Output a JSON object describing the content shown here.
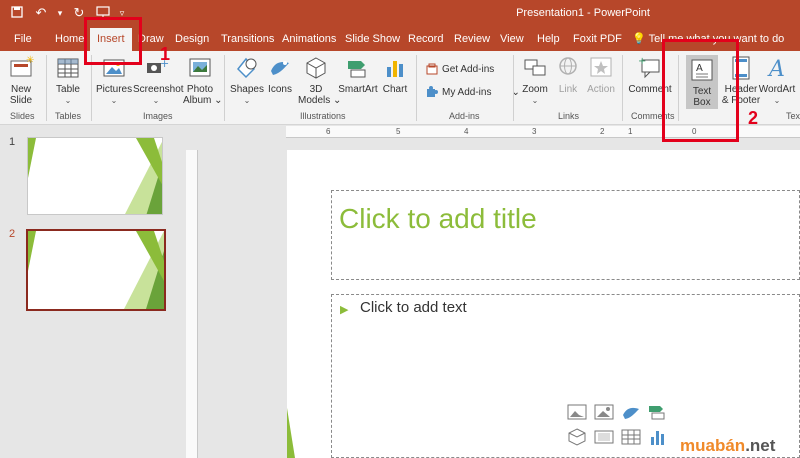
{
  "app_title": "Presentation1 - PowerPoint",
  "tabs": [
    "File",
    "Home",
    "Insert",
    "Draw",
    "Design",
    "Transitions",
    "Animations",
    "Slide Show",
    "Record",
    "Review",
    "View",
    "Help",
    "Foxit PDF"
  ],
  "active_tab": "Insert",
  "tell_me": "Tell me what you want to do",
  "ribbon": {
    "new_slide": "New",
    "new_slide_2": "Slide",
    "table": "Table",
    "pictures": "Pictures",
    "screenshot": "Screenshot",
    "photo_album": "Photo",
    "photo_album_2": "Album",
    "shapes": "Shapes",
    "icons": "Icons",
    "models_3d": "3D",
    "models_3d_2": "Models",
    "smartart": "SmartArt",
    "chart": "Chart",
    "get_addins": "Get Add-ins",
    "my_addins": "My Add-ins",
    "zoom": "Zoom",
    "link": "Link",
    "action": "Action",
    "comment": "Comment",
    "text_box": "Text",
    "text_box_2": "Box",
    "header_footer": "Header",
    "header_footer_2": "& Footer",
    "wordart": "WordArt",
    "groups": {
      "slides": "Slides",
      "tables": "Tables",
      "images": "Images",
      "illustrations": "Illustrations",
      "addins": "Add-ins",
      "links": "Links",
      "comments": "Comments",
      "text": "Text"
    }
  },
  "ruler_ticks": [
    "6",
    "5",
    "4",
    "3",
    "2",
    "1",
    "0"
  ],
  "thumbnails": [
    {
      "number": "1"
    },
    {
      "number": "2"
    }
  ],
  "slide": {
    "title_placeholder": "Click to add title",
    "body_placeholder": "Click to add text",
    "bullet": "▶"
  },
  "annotations": {
    "step1": "1",
    "step2": "2"
  },
  "watermark": {
    "main": "muabán",
    "suffix": ".net"
  },
  "colors": {
    "accent": "#b7472a",
    "green": "#8cbc3a",
    "highlight": "#e3001b"
  }
}
